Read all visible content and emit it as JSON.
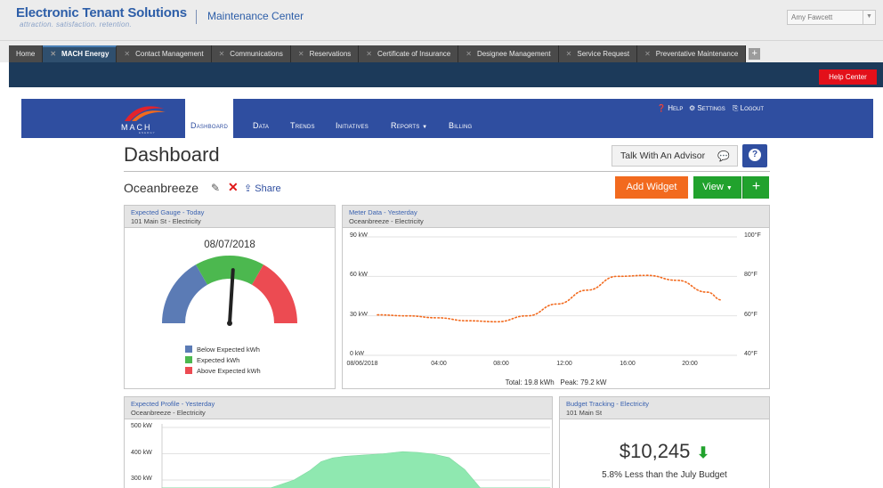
{
  "app": {
    "brand": "Electronic Tenant Solutions",
    "tagline": "attraction. satisfaction. retention.",
    "title": "Maintenance Center",
    "user": "Amy Fawcett"
  },
  "tabs": [
    {
      "label": "Home",
      "closable": false,
      "active": false
    },
    {
      "label": "MACH Energy",
      "closable": true,
      "active": true
    },
    {
      "label": "Contact Management",
      "closable": true,
      "active": false
    },
    {
      "label": "Communications",
      "closable": true,
      "active": false
    },
    {
      "label": "Reservations",
      "closable": true,
      "active": false
    },
    {
      "label": "Certificate of Insurance",
      "closable": true,
      "active": false
    },
    {
      "label": "Designee Management",
      "closable": true,
      "active": false
    },
    {
      "label": "Service Request",
      "closable": true,
      "active": false
    },
    {
      "label": "Preventative Maintenance",
      "closable": true,
      "active": false
    }
  ],
  "help_center": "Help Center",
  "mach": {
    "logo_word": "MACH",
    "logo_sub": "ENERGY",
    "nav": {
      "dashboard": "Dashboard",
      "data": "Data",
      "trends": "Trends",
      "initiatives": "Initiatives",
      "reports": "Reports",
      "billing": "Billing"
    },
    "util": {
      "help": "Help",
      "settings": "Settings",
      "logout": "Logout"
    }
  },
  "dashboard": {
    "title": "Dashboard",
    "advisor": "Talk With An Advisor",
    "help": "?",
    "name": "Oceanbreeze",
    "share": "Share",
    "add_widget": "Add Widget",
    "view": "View",
    "add": "+"
  },
  "gauge_widget": {
    "title": "Expected Gauge - Today",
    "subtitle": "101 Main St - Electricity",
    "date": "08/07/2018",
    "needle_fraction": 0.52,
    "legend": [
      {
        "label": "Below Expected kWh",
        "color": "#5b7bb5"
      },
      {
        "label": "Expected kWh",
        "color": "#4cb84f"
      },
      {
        "label": "Above Expected kWh",
        "color": "#ec4b52"
      }
    ]
  },
  "meter_widget": {
    "title": "Meter Data - Yesterday",
    "subtitle": "Oceanbreeze - Electricity",
    "total": "Total: 19.8 kWh",
    "peak": "Peak: 79.2 kW"
  },
  "profile_widget": {
    "title": "Expected Profile - Yesterday",
    "subtitle": "Oceanbreeze - Electricity"
  },
  "budget_widget": {
    "title": "Budget Tracking - Electricity",
    "subtitle": "101 Main St",
    "amount": "$10,245",
    "note": "5.8% Less than the July Budget",
    "trend_color": "#21a22d"
  },
  "chart_data": [
    {
      "type": "line",
      "title": "Meter Data - Yesterday",
      "x_ticks": [
        "08/06/2018",
        "04:00",
        "08:00",
        "12:00",
        "16:00",
        "20:00"
      ],
      "x": [
        0,
        2,
        4,
        6,
        8,
        10,
        12,
        14,
        16,
        18,
        20,
        22,
        23
      ],
      "y_ticks": [
        "0 kW",
        "30 kW",
        "60 kW",
        "90 kW"
      ],
      "ylim": [
        0,
        90
      ],
      "y2_ticks": [
        "40°F",
        "60°F",
        "80°F",
        "100°F"
      ],
      "y2lim": [
        40,
        100
      ],
      "series": [
        {
          "values": [
            60.5,
            60,
            59,
            57.5,
            57,
            60,
            66,
            73,
            80,
            80.5,
            78,
            72,
            68
          ],
          "axis": "y2",
          "color": "#f26a1e",
          "style": "dotted"
        }
      ],
      "grid": true
    },
    {
      "type": "area",
      "title": "Expected Profile - Yesterday",
      "y_ticks": [
        "300 kW",
        "400 kW",
        "500 kW"
      ],
      "ylim": [
        270,
        500
      ],
      "x": [
        0.0,
        0.28,
        0.34,
        0.38,
        0.41,
        0.44,
        0.47,
        0.52,
        0.57,
        0.62,
        0.66,
        0.7,
        0.74,
        0.78,
        0.82,
        1.0
      ],
      "values": [
        270,
        270,
        300,
        335,
        370,
        384,
        390,
        395,
        400,
        408,
        405,
        398,
        385,
        340,
        270,
        270
      ],
      "color": "#8fe8b0"
    }
  ]
}
